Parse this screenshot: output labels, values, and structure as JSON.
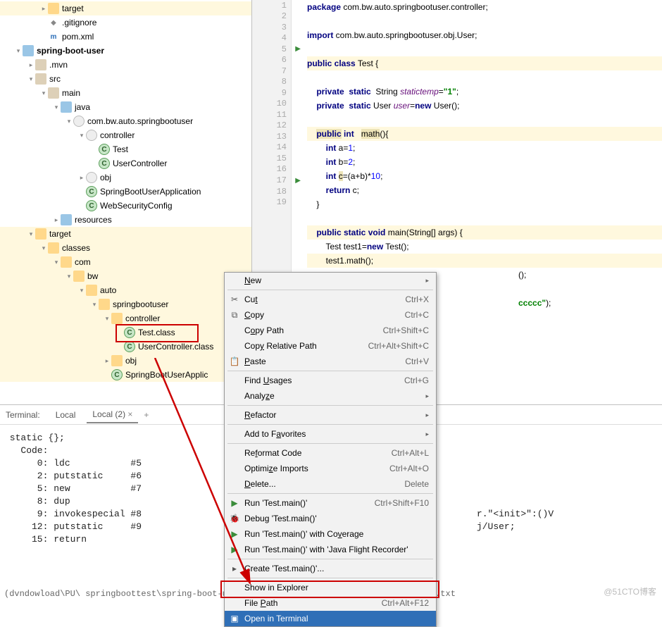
{
  "tree": {
    "items": [
      {
        "indent": 2,
        "arrow": ">",
        "icon": "folder-open",
        "label": "target",
        "hl": true
      },
      {
        "indent": 2,
        "arrow": "",
        "icon": "file-git",
        "label": ".gitignore"
      },
      {
        "indent": 2,
        "arrow": "",
        "icon": "file-m",
        "label": "pom.xml",
        "iconText": "m"
      },
      {
        "indent": 0,
        "arrow": "v",
        "icon": "folder-blue",
        "label": "spring-boot-user",
        "bold": true
      },
      {
        "indent": 1,
        "arrow": ">",
        "icon": "folder-closed",
        "label": ".mvn"
      },
      {
        "indent": 1,
        "arrow": "v",
        "icon": "folder-closed",
        "label": "src"
      },
      {
        "indent": 2,
        "arrow": "v",
        "icon": "folder-closed",
        "label": "main"
      },
      {
        "indent": 3,
        "arrow": "v",
        "icon": "folder-blue",
        "label": "java"
      },
      {
        "indent": 4,
        "arrow": "v",
        "icon": "pkg",
        "label": "com.bw.auto.springbootuser"
      },
      {
        "indent": 5,
        "arrow": "v",
        "icon": "pkg",
        "label": "controller"
      },
      {
        "indent": 6,
        "arrow": "",
        "icon": "classicon",
        "iconText": "C",
        "label": "Test"
      },
      {
        "indent": 6,
        "arrow": "",
        "icon": "classicon",
        "iconText": "C",
        "label": "UserController"
      },
      {
        "indent": 5,
        "arrow": ">",
        "icon": "pkg",
        "label": "obj"
      },
      {
        "indent": 5,
        "arrow": "",
        "icon": "classicon",
        "iconText": "C",
        "label": "SpringBootUserApplication"
      },
      {
        "indent": 5,
        "arrow": "",
        "icon": "classicon",
        "iconText": "C",
        "label": "WebSecurityConfig"
      },
      {
        "indent": 3,
        "arrow": ">",
        "icon": "folder-blue",
        "label": "resources"
      },
      {
        "indent": 1,
        "arrow": "v",
        "icon": "folder-open",
        "label": "target",
        "hl": true
      },
      {
        "indent": 2,
        "arrow": "v",
        "icon": "folder-open",
        "label": "classes",
        "hl": true
      },
      {
        "indent": 3,
        "arrow": "v",
        "icon": "folder-open",
        "label": "com",
        "hl": true
      },
      {
        "indent": 4,
        "arrow": "v",
        "icon": "folder-open",
        "label": "bw",
        "hl": true
      },
      {
        "indent": 5,
        "arrow": "v",
        "icon": "folder-open",
        "label": "auto",
        "hl": true
      },
      {
        "indent": 6,
        "arrow": "v",
        "icon": "folder-open",
        "label": "springbootuser",
        "hl": true
      },
      {
        "indent": 7,
        "arrow": "v",
        "icon": "folder-open",
        "label": "controller",
        "hl": true
      },
      {
        "indent": 8,
        "arrow": "",
        "icon": "classicon",
        "iconText": "C",
        "label": "Test.class",
        "hl": true,
        "selbox": true
      },
      {
        "indent": 8,
        "arrow": "",
        "icon": "classicon",
        "iconText": "C",
        "label": "UserController.class",
        "hl": true
      },
      {
        "indent": 7,
        "arrow": ">",
        "icon": "folder-open",
        "label": "obj",
        "hl": true
      },
      {
        "indent": 7,
        "arrow": "",
        "icon": "classicon",
        "iconText": "C",
        "label": "SpringBootUserApplic",
        "hl": true
      }
    ]
  },
  "code": {
    "lines": [
      {
        "n": "1",
        "html": "<span class='kw'>package</span> com.bw.auto.springbootuser.controller;"
      },
      {
        "n": "2",
        "html": ""
      },
      {
        "n": "3",
        "html": "<span class='kw'>import</span> com.bw.auto.springbootuser.obj.User;"
      },
      {
        "n": "4",
        "html": ""
      },
      {
        "n": "5",
        "html": "<span class='kw'>public class</span> Test {",
        "run": true,
        "hl": true
      },
      {
        "n": "6",
        "html": ""
      },
      {
        "n": "7",
        "html": "    <span class='kw'>private  static</span>  String <span class='field'>statictemp</span>=<span class='str'>\"1\"</span>;"
      },
      {
        "n": "8",
        "html": "    <span class='kw'>private  static</span> User <span class='field'>user</span>=<span class='kw'>new</span> User();"
      },
      {
        "n": "9",
        "html": ""
      },
      {
        "n": "10",
        "html": "    <span class='bg-y'><span class='kw'>public</span></span> <span class='kw'>int</span>   <span class='bg-y'>math</span>(){",
        "hl": true
      },
      {
        "n": "11",
        "html": "        <span class='kw'>int</span> a=<span style='color:#0000ff'>1</span>;"
      },
      {
        "n": "12",
        "html": "        <span class='kw'>int</span> b=<span style='color:#0000ff'>2</span>;"
      },
      {
        "n": "13",
        "html": "        <span class='kw'>int</span> <span class='bg-y'>c</span>=(a+b)*<span style='color:#0000ff'>10</span>;"
      },
      {
        "n": "14",
        "html": "        <span class='kw'>return</span> c;"
      },
      {
        "n": "15",
        "html": "    }"
      },
      {
        "n": "16",
        "html": ""
      },
      {
        "n": "17",
        "html": "    <span class='kw'>public static void</span> main(String[] args) {",
        "run": true,
        "hl": true
      },
      {
        "n": "18",
        "html": "        Test test1=<span class='kw'>new</span> Test();"
      },
      {
        "n": "19",
        "html": "        test1.math();",
        "hl": true
      }
    ],
    "after_menu": [
      "();",
      "",
      "<span class='str'>ccccc\"</span>);",
      "",
      "",
      "",
      "",
      "",
      "",
      "",
      "",
      "",
      "",
      "",
      "",
      "",
      "",
      ""
    ]
  },
  "menu": [
    {
      "type": "item",
      "label": "<span class='u'>N</span>ew",
      "sub": ">"
    },
    {
      "type": "sep"
    },
    {
      "type": "item",
      "label": "Cu<span class='u'>t</span>",
      "sc": "Ctrl+X",
      "icon": "✂"
    },
    {
      "type": "item",
      "label": "<span class='u'>C</span>opy",
      "sc": "Ctrl+C",
      "icon": "⧉"
    },
    {
      "type": "item",
      "label": "C<span class='u'>o</span>py Path",
      "sc": "Ctrl+Shift+C"
    },
    {
      "type": "item",
      "label": "Cop<span class='u'>y</span> Relative Path",
      "sc": "Ctrl+Alt+Shift+C"
    },
    {
      "type": "item",
      "label": "<span class='u'>P</span>aste",
      "sc": "Ctrl+V",
      "icon": "📋"
    },
    {
      "type": "sep"
    },
    {
      "type": "item",
      "label": "Find <span class='u'>U</span>sages",
      "sc": "Ctrl+G"
    },
    {
      "type": "item",
      "label": "Analy<span class='u'>z</span>e",
      "sub": ">"
    },
    {
      "type": "sep"
    },
    {
      "type": "item",
      "label": "<span class='u'>R</span>efactor",
      "sub": ">"
    },
    {
      "type": "sep"
    },
    {
      "type": "item",
      "label": "Add to F<span class='u'>a</span>vorites",
      "sub": ">"
    },
    {
      "type": "sep"
    },
    {
      "type": "item",
      "label": "Re<span class='u'>f</span>ormat Code",
      "sc": "Ctrl+Alt+L"
    },
    {
      "type": "item",
      "label": "Optimi<span class='u'>z</span>e Imports",
      "sc": "Ctrl+Alt+O"
    },
    {
      "type": "item",
      "label": "<span class='u'>D</span>elete...",
      "sc": "Delete"
    },
    {
      "type": "sep"
    },
    {
      "type": "item",
      "label": "Run 'Test.main()'",
      "sc": "Ctrl+Shift+F10",
      "icon": "▶",
      "iconColor": "#3a8c3a"
    },
    {
      "type": "item",
      "label": "Debug 'Test.main()'",
      "icon": "🐞",
      "iconColor": "#3a8c3a"
    },
    {
      "type": "item",
      "label": "Run 'Test.main()' with Co<span class='u'>v</span>erage",
      "icon": "▶",
      "iconColor": "#3a8c3a"
    },
    {
      "type": "item",
      "label": "Run 'Test.main()' with 'Java Flight Recorder'",
      "icon": "▶",
      "iconColor": "#3a8c3a"
    },
    {
      "type": "sep"
    },
    {
      "type": "item",
      "label": "Create 'Test.main()'...",
      "icon": "▸"
    },
    {
      "type": "sep"
    },
    {
      "type": "item",
      "label": "Show in Explorer"
    },
    {
      "type": "item",
      "label": "File <span class='u'>P</span>ath",
      "sc": "Ctrl+Alt+F12"
    },
    {
      "type": "item",
      "label": "Open in Terminal",
      "sel": true,
      "icon": "▣"
    }
  ],
  "terminal": {
    "label": "Terminal:",
    "tab1": "Local",
    "tab2": "Local (2)",
    "close": "×",
    "plus": "+",
    "body": " static {};\n   Code:\n      0: ldc           #5\n      2: putstatic     #6                  //\n      5: new           #7                  //\n      8: dup\n      9: invokespecial #8                  //                                         r.\"<init>\":()V\n     12: putstatic     #9                  //                                         j/User;\n     15: return\n"
  },
  "bottom_path": "(dvndowload\\PU\\ springboottest\\spring-boot-us                                                  on\\controllon>javan -c Tots.class >tost.txt",
  "watermark": "@51CTO博客"
}
